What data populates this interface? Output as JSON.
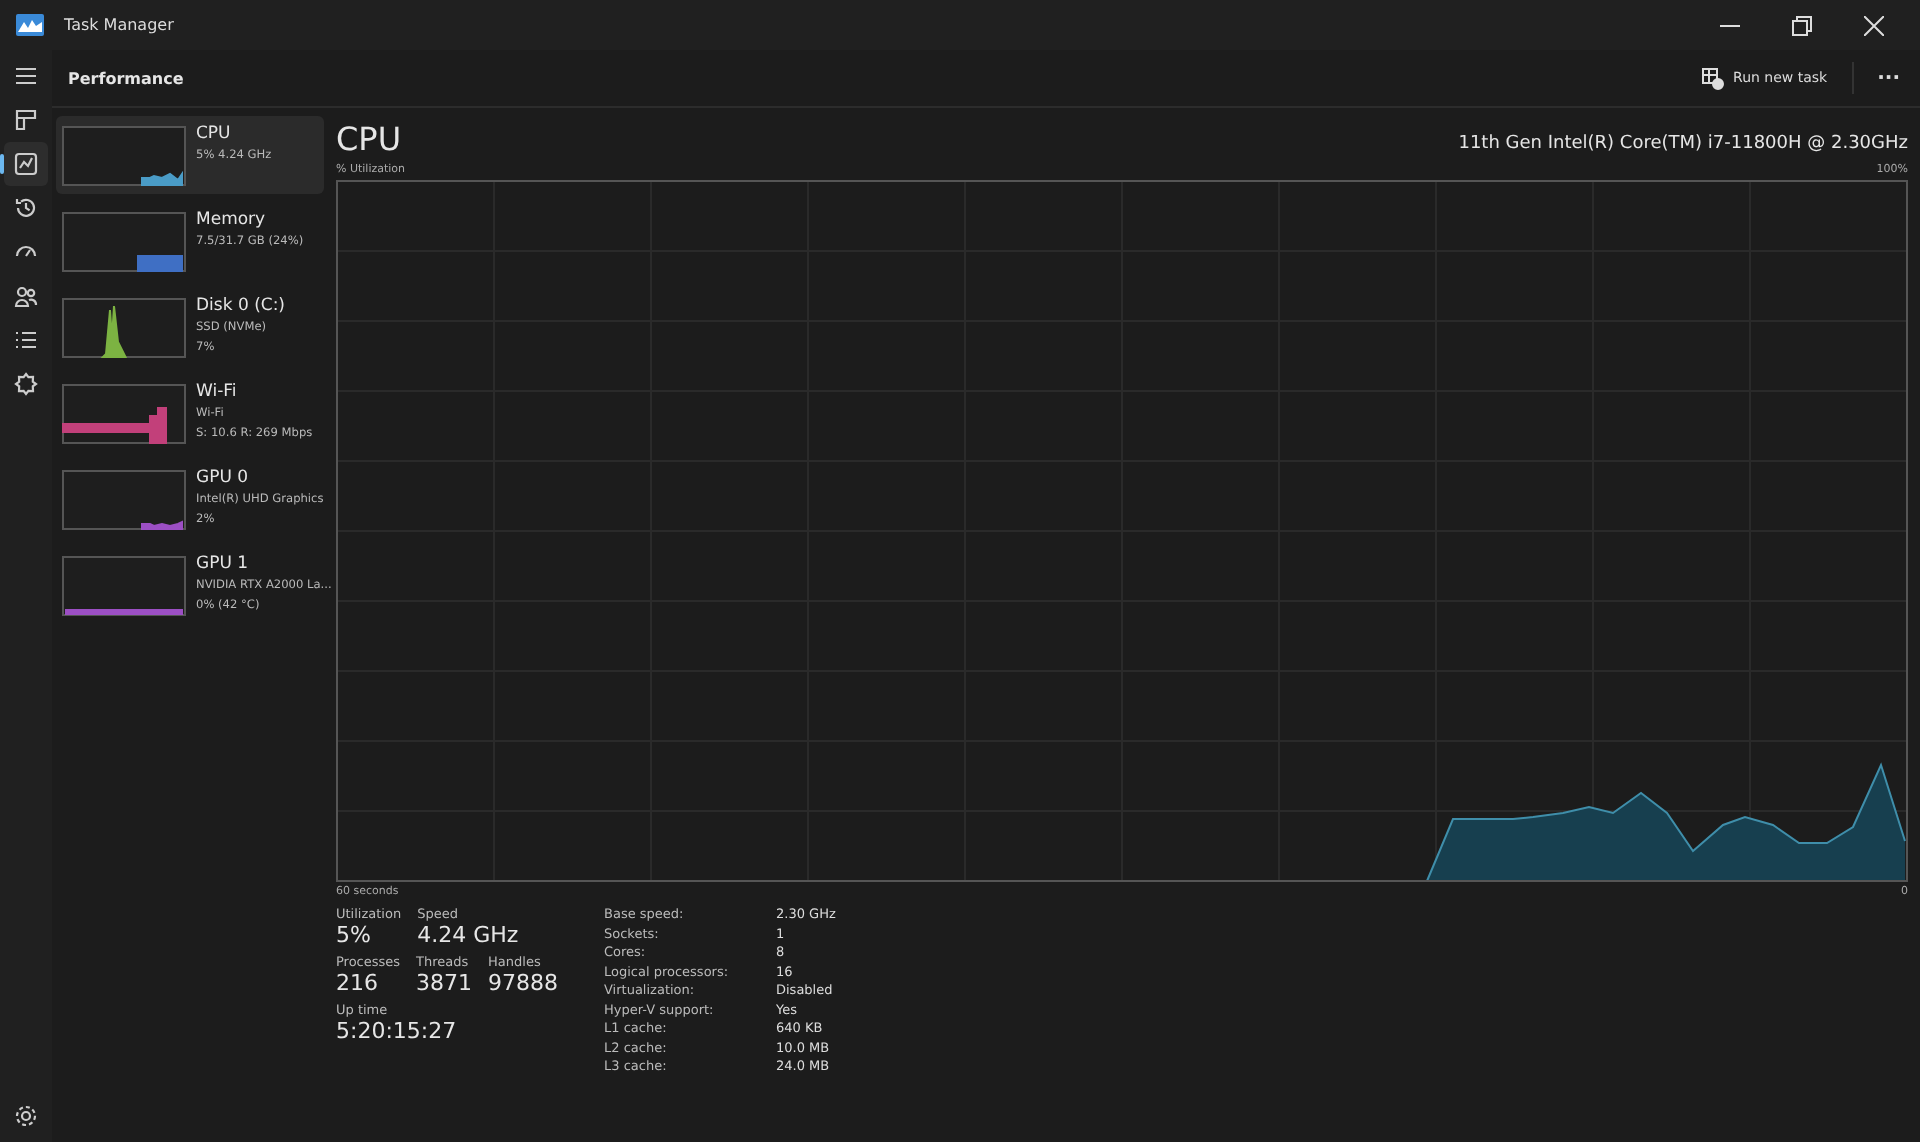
{
  "window": {
    "title": "Task Manager"
  },
  "nav": [
    {
      "kind": "menu",
      "selected": false
    },
    {
      "kind": "processes",
      "selected": false
    },
    {
      "kind": "performance",
      "selected": true
    },
    {
      "kind": "history",
      "selected": false
    },
    {
      "kind": "startup",
      "selected": false
    },
    {
      "kind": "users",
      "selected": false
    },
    {
      "kind": "details",
      "selected": false
    },
    {
      "kind": "services",
      "selected": false
    }
  ],
  "header": {
    "title": "Performance",
    "run_new_task": "Run new task",
    "more": "···"
  },
  "devices": [
    {
      "name": "CPU",
      "line1": "5% 4.24 GHz",
      "color": "#4a9cc7",
      "selected": true
    },
    {
      "name": "Memory",
      "line1": "7.5/31.7 GB (24%)",
      "color": "#3f6fc4",
      "selected": false
    },
    {
      "name": "Disk 0 (C:)",
      "line1": "SSD (NVMe)",
      "line2": "7%",
      "color": "#7cb342",
      "selected": false
    },
    {
      "name": "Wi-Fi",
      "line1": "Wi-Fi",
      "line2": "S: 10.6  R: 269 Mbps",
      "color": "#c2407a",
      "selected": false
    },
    {
      "name": "GPU 0",
      "line1": "Intel(R) UHD Graphics",
      "line2": "2%",
      "color": "#9c4fc4",
      "selected": false
    },
    {
      "name": "GPU 1",
      "line1": "NVIDIA RTX A2000 La...",
      "line2": "0% (42 °C)",
      "color": "#9c4fc4",
      "selected": false
    }
  ],
  "main": {
    "title": "CPU",
    "model": "11th Gen Intel(R) Core(TM) i7-11800H @ 2.30GHz",
    "y_label": "% Utilization",
    "y_max": "100%",
    "x_label": "60 seconds",
    "x_min": "0"
  },
  "stats": [
    [
      {
        "label": "Utilization",
        "value": "5%"
      },
      {
        "label": "Speed",
        "value": "4.24 GHz"
      }
    ],
    [
      {
        "label": "Processes",
        "value": "216"
      },
      {
        "label": "Threads",
        "value": "3871"
      },
      {
        "label": "Handles",
        "value": "97888"
      }
    ],
    [
      {
        "label": "Up time",
        "value": "5:20:15:27"
      }
    ]
  ],
  "details": [
    {
      "label": "Base speed:",
      "value": "2.30 GHz"
    },
    {
      "label": "Sockets:",
      "value": "1"
    },
    {
      "label": "Cores:",
      "value": "8"
    },
    {
      "label": "Logical processors:",
      "value": "16"
    },
    {
      "label": "Virtualization:",
      "value": "Disabled"
    },
    {
      "label": "Hyper-V support:",
      "value": "Yes"
    },
    {
      "label": "L1 cache:",
      "value": "640 KB"
    },
    {
      "label": "L2 cache:",
      "value": "10.0 MB"
    },
    {
      "label": "L3 cache:",
      "value": "24.0 MB"
    }
  ]
}
